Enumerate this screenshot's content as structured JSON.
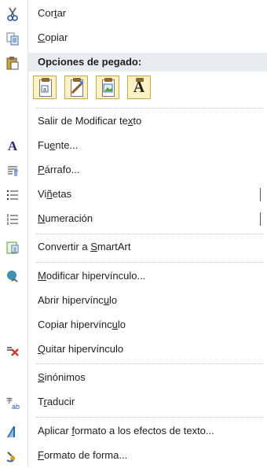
{
  "menu": {
    "cut": {
      "pre": "Cor",
      "u": "t",
      "post": "ar"
    },
    "copy": {
      "pre": "",
      "u": "C",
      "post": "opiar"
    },
    "paste_header": "Opciones de pegado:",
    "exit_edit": {
      "pre": "Salir de Modificar te",
      "u": "x",
      "post": "to"
    },
    "font": {
      "pre": "Fu",
      "u": "e",
      "post": "nte..."
    },
    "paragraph": {
      "pre": "",
      "u": "P",
      "post": "árrafo..."
    },
    "bullets": {
      "pre": "Vi",
      "u": "ñ",
      "post": "etas"
    },
    "numbering": {
      "pre": "",
      "u": "N",
      "post": "umeración"
    },
    "smartart": {
      "pre": "Convertir a ",
      "u": "S",
      "post": "martArt"
    },
    "edit_link": {
      "pre": "",
      "u": "M",
      "post": "odificar hipervínculo..."
    },
    "open_link": {
      "pre": "Abrir hipervínc",
      "u": "u",
      "post": "lo"
    },
    "copy_link": {
      "pre": "Copiar hipervínc",
      "u": "u",
      "post": "lo"
    },
    "remove_link": {
      "pre": "",
      "u": "Q",
      "post": "uitar hipervínculo"
    },
    "synonyms": {
      "pre": "",
      "u": "S",
      "post": "inónimos"
    },
    "translate": {
      "pre": "T",
      "u": "r",
      "post": "aducir"
    },
    "text_effects": {
      "pre": "Aplicar ",
      "u": "f",
      "post": "ormato a los efectos de texto..."
    },
    "format_shape": {
      "pre": "",
      "u": "F",
      "post": "ormato de forma..."
    }
  },
  "paste_buttons": [
    {
      "icon": "paste-keep-source-icon"
    },
    {
      "icon": "paste-merge-format-icon"
    },
    {
      "icon": "paste-picture-icon"
    },
    {
      "icon": "paste-text-only-icon",
      "glyph": "A"
    }
  ],
  "colors": {
    "header_bg": "#e9ebef",
    "paste_btn_border": "#c9a64a",
    "paste_btn_bg": "#fdf2c5"
  }
}
